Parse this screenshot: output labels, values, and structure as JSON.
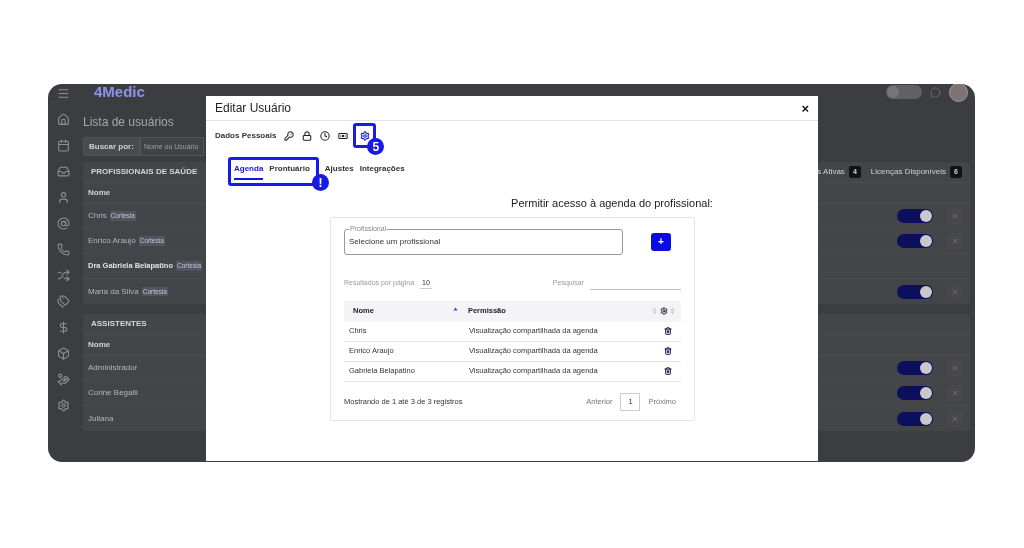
{
  "app": {
    "logo": "4Medic",
    "theme_toggle_on": false,
    "page_title": "Lista de usuários",
    "search": {
      "label": "Buscar por:",
      "placeholder": "Nome ou Usuário"
    },
    "licenses": [
      {
        "label": "s Ativas",
        "count": "4"
      },
      {
        "label": "Licenças Disponíveis",
        "count": "6"
      }
    ],
    "sections": [
      {
        "title": "PROFISSIONAIS DE SAÚDE",
        "column": "Nome",
        "rows": [
          {
            "name": "Chris",
            "tag": "Cortesia",
            "kind": "user",
            "active": true
          },
          {
            "name": "Enrico Araujo",
            "tag": "Cortesia",
            "kind": "user",
            "active": true
          },
          {
            "name": "Dra Gabriela Belapatino",
            "tag": "Cortesia",
            "kind": "owner"
          },
          {
            "name": "Maria da Silva",
            "tag": "Cortesia",
            "kind": "user",
            "active": true
          }
        ]
      },
      {
        "title": "ASSISTENTES",
        "column": "Nome",
        "rows": [
          {
            "name": "Administrador",
            "kind": "user",
            "active": true
          },
          {
            "name": "Corine Begalli",
            "kind": "user",
            "active": true
          },
          {
            "name": "Juliana",
            "kind": "user",
            "active": true
          }
        ]
      }
    ]
  },
  "modal": {
    "title": "Editar Usuário",
    "close": "×",
    "toolbar": {
      "label": "Dados Pessoais",
      "icons": [
        {
          "selected": false
        },
        {
          "selected": false
        },
        {
          "selected": false
        },
        {
          "selected": false
        },
        {
          "selected": true
        }
      ]
    },
    "tabs": [
      {
        "label": "Agenda",
        "selected": true
      },
      {
        "label": "Prontuário",
        "selected": false
      },
      {
        "label": "Ajustes",
        "selected": false
      },
      {
        "label": "Integrações",
        "selected": false
      }
    ],
    "callouts": [
      {
        "badge": "5"
      },
      {
        "badge": "!"
      }
    ],
    "heading": "Permitir acesso à agenda do profissional:",
    "field": {
      "label": "Profissional",
      "value": "Selecione um profissional"
    },
    "add_button": "+",
    "page_size": {
      "label": "Resultados por página",
      "value": "10"
    },
    "search_label": "Pesquisar",
    "table": {
      "columns": [
        {
          "kind": "text",
          "label": "Nome",
          "sorted": true
        },
        {
          "kind": "text",
          "label": "Permissão",
          "sorted": false
        },
        {
          "kind": "settings",
          "sorted": false
        }
      ],
      "rows": [
        {
          "name": "Chris",
          "permission": "Visualização compartilhada da agenda"
        },
        {
          "name": "Enrico Araujo",
          "permission": "Visualização compartilhada da agenda"
        },
        {
          "name": "Gabriela Belapatino",
          "permission": "Visualização compartilhada da agenda"
        }
      ]
    },
    "footer": {
      "summary": "Mostrando de 1 até 3 de 3 registros",
      "prev": "Anterior",
      "page": "1",
      "next": "Próximo"
    }
  }
}
